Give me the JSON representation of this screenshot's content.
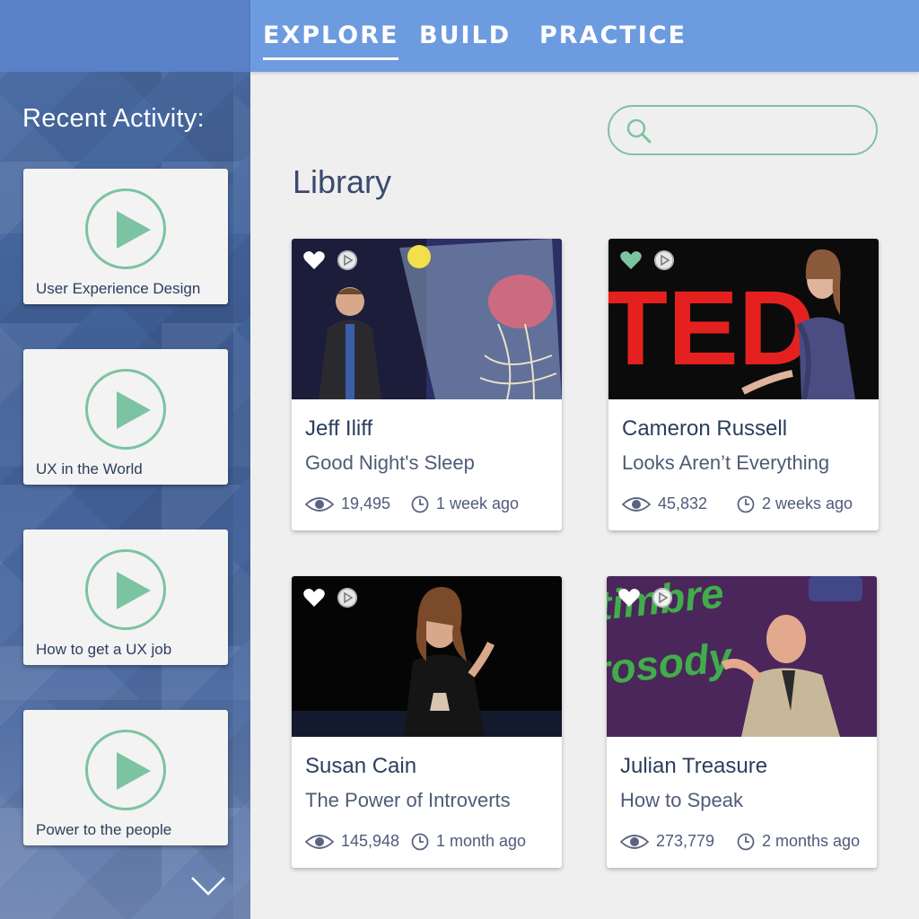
{
  "nav": {
    "items": [
      {
        "label": "EXPLORE",
        "active": true
      },
      {
        "label": "BUILD",
        "active": false
      },
      {
        "label": "PRACTICE",
        "active": false
      }
    ]
  },
  "sidebar": {
    "title": "Recent Activity:",
    "items": [
      {
        "label": "User Experience Design"
      },
      {
        "label": "UX in the World"
      },
      {
        "label": "How to get a UX job"
      },
      {
        "label": "Power to the people"
      }
    ],
    "scroll_icon": "chevron-down-icon"
  },
  "search": {
    "placeholder": "",
    "value": "",
    "icon": "search-icon"
  },
  "library": {
    "title": "Library",
    "cards": [
      {
        "speaker": "Jeff Iliff",
        "talk": "Good Night's Sleep",
        "views": "19,495",
        "ago": "1 week ago",
        "favorited": false
      },
      {
        "speaker": "Cameron Russell",
        "talk": "Looks Aren’t Everything",
        "views": "45,832",
        "ago": "2 weeks ago",
        "favorited": true
      },
      {
        "speaker": "Susan Cain",
        "talk": "The Power of Introverts",
        "views": "145,948",
        "ago": "1 month ago",
        "favorited": false
      },
      {
        "speaker": "Julian Treasure",
        "talk": "How to Speak",
        "views": "273,779",
        "ago": "2 months ago",
        "favorited": false
      }
    ],
    "thumb_text": {
      "card2": "TED",
      "card4": "timbre\nrosody"
    }
  },
  "colors": {
    "accent_green": "#7cc3a1",
    "nav_blue": "#6d9be0",
    "text_navy": "#2c3e5e"
  }
}
